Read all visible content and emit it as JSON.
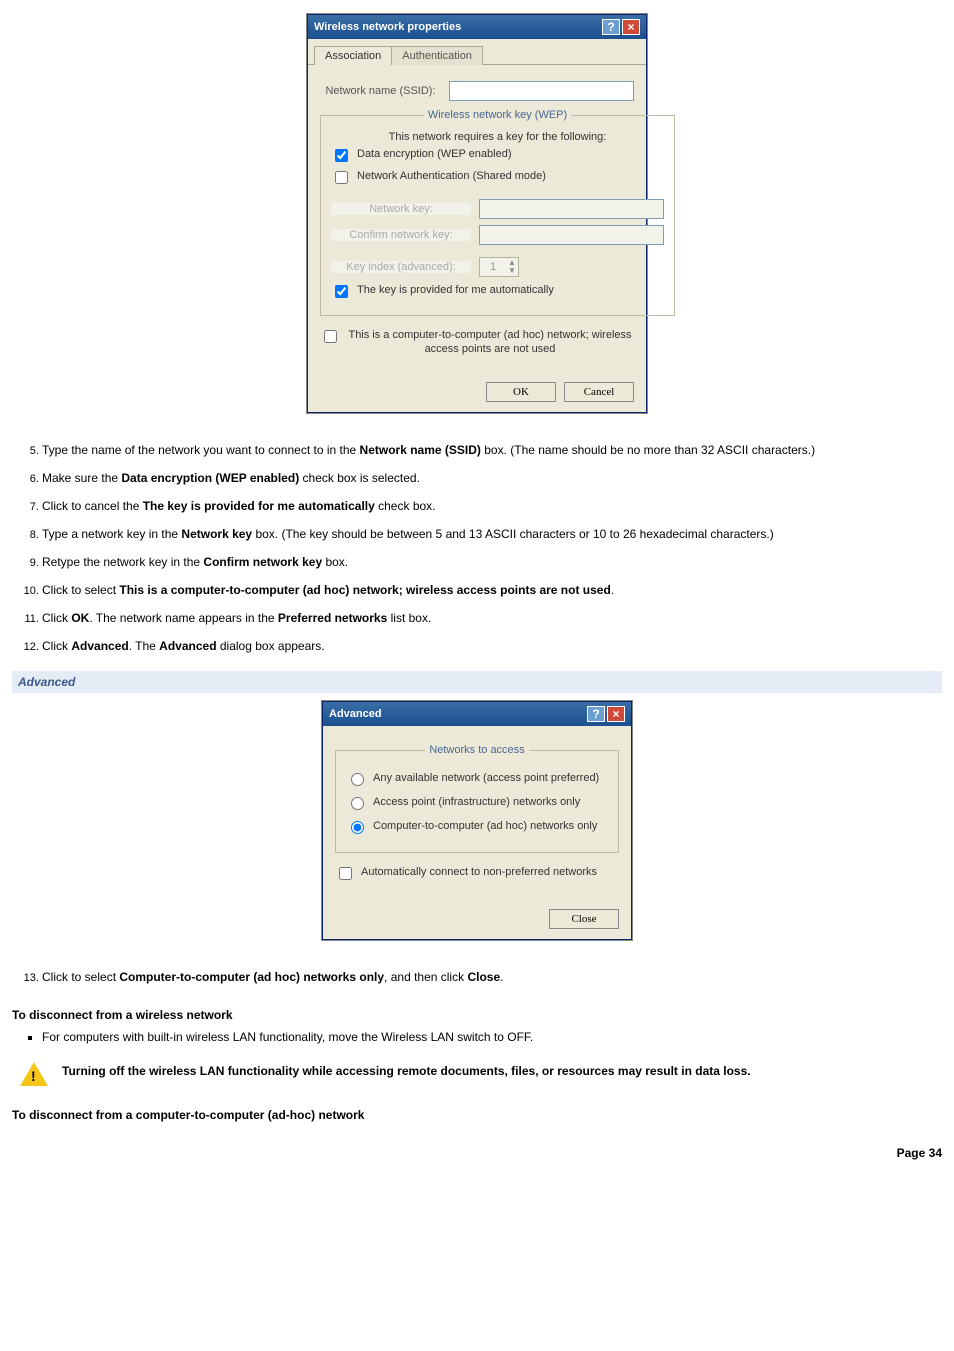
{
  "dialog1": {
    "title": "Wireless network properties",
    "tabs": {
      "association": "Association",
      "authentication": "Authentication"
    },
    "ssid_label": "Network name (SSID):",
    "ssid_value": "",
    "wep_legend": "Wireless network key (WEP)",
    "wep_intro": "This network requires a key for the following:",
    "chk_data_enc": "Data encryption (WEP enabled)",
    "chk_net_auth": "Network Authentication (Shared mode)",
    "netkey_label": "Network key:",
    "confirm_label": "Confirm network key:",
    "keyidx_label": "Key index (advanced):",
    "keyidx_value": "1",
    "chk_auto_key": "The key is provided for me automatically",
    "chk_adhoc": "This is a computer-to-computer (ad hoc) network; wireless access points are not used",
    "ok": "OK",
    "cancel": "Cancel"
  },
  "steps_a": {
    "s5a": "Type the name of the network you want to connect to in the ",
    "s5b": "Network name (SSID)",
    "s5c": " box. (The name should be no more than 32 ASCII characters.)",
    "s6a": "Make sure the ",
    "s6b": "Data encryption (WEP enabled)",
    "s6c": " check box is selected.",
    "s7a": "Click to cancel the ",
    "s7b": "The key is provided for me automatically",
    "s7c": " check box.",
    "s8a": "Type a network key in the ",
    "s8b": "Network key",
    "s8c": " box. (The key should be between 5 and 13 ASCII characters or 10 to 26 hexadecimal characters.)",
    "s9a": "Retype the network key in the ",
    "s9b": "Confirm network key",
    "s9c": " box.",
    "s10a": "Click to select ",
    "s10b": "This is a computer-to-computer (ad hoc) network; wireless access points are not used",
    "s10c": ".",
    "s11a": "Click ",
    "s11b": "OK",
    "s11c": ". The network name appears in the ",
    "s11d": "Preferred networks",
    "s11e": " list box.",
    "s12a": "Click ",
    "s12b": "Advanced",
    "s12c": ". The ",
    "s12d": "Advanced",
    "s12e": " dialog box appears."
  },
  "adv_heading": "Advanced",
  "dialog2": {
    "title": "Advanced",
    "legend": "Networks to access",
    "opt1": "Any available network (access point preferred)",
    "opt2": "Access point (infrastructure) networks only",
    "opt3": "Computer-to-computer (ad hoc) networks only",
    "chk_auto": "Automatically connect to non-preferred networks",
    "close": "Close"
  },
  "steps_b": {
    "s13a": "Click to select ",
    "s13b": "Computer-to-computer (ad hoc) networks only",
    "s13c": ", and then click ",
    "s13d": "Close",
    "s13e": "."
  },
  "disc1_h": "To disconnect from a wireless network",
  "disc1_li": "For computers with built-in wireless LAN functionality, move the Wireless LAN switch to OFF.",
  "warn": "Turning off the wireless LAN functionality while accessing remote documents, files, or resources may result in data loss.",
  "disc2_h": "To disconnect from a computer-to-computer (ad-hoc) network",
  "page": "Page 34"
}
